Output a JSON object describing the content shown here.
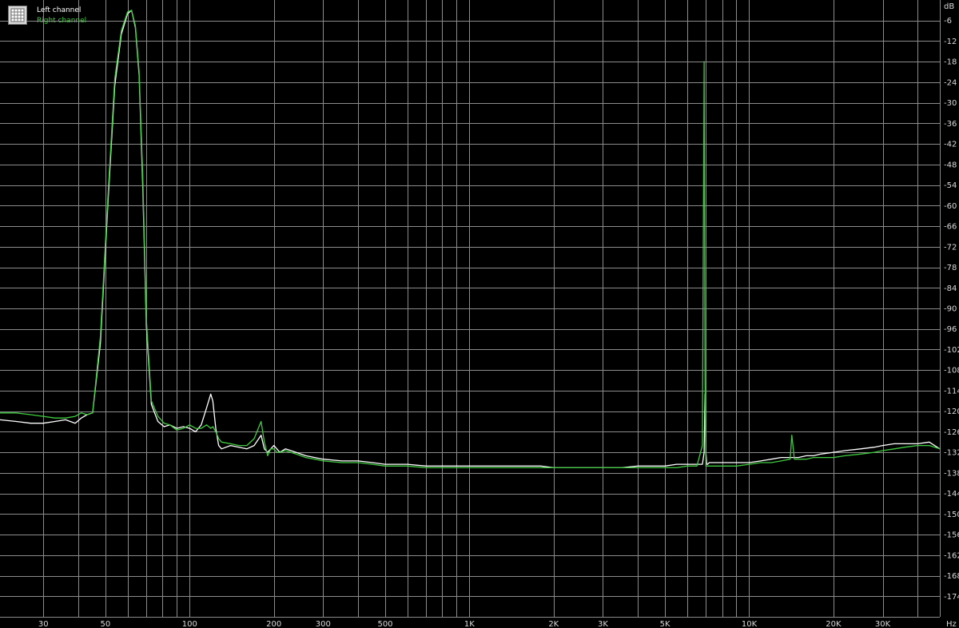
{
  "chart_data": {
    "type": "line",
    "x_scale": "log",
    "xlim": [
      21,
      48000
    ],
    "ylim": [
      -180,
      0
    ],
    "x_unit": "Hz",
    "y_unit": "dB",
    "x_tick_labels": [
      {
        "x": 30,
        "label": "30"
      },
      {
        "x": 50,
        "label": "50"
      },
      {
        "x": 100,
        "label": "100"
      },
      {
        "x": 200,
        "label": "200"
      },
      {
        "x": 300,
        "label": "300"
      },
      {
        "x": 500,
        "label": "500"
      },
      {
        "x": 1000,
        "label": "1K"
      },
      {
        "x": 2000,
        "label": "2K"
      },
      {
        "x": 3000,
        "label": "3K"
      },
      {
        "x": 5000,
        "label": "5K"
      },
      {
        "x": 10000,
        "label": "10K"
      },
      {
        "x": 20000,
        "label": "20K"
      },
      {
        "x": 30000,
        "label": "30K"
      }
    ],
    "y_ticks": [
      -6,
      -12,
      -18,
      -24,
      -30,
      -36,
      -42,
      -48,
      -54,
      -60,
      -66,
      -72,
      -78,
      -84,
      -90,
      -96,
      -102,
      -108,
      -114,
      -120,
      -126,
      -132,
      -138,
      -144,
      -150,
      -156,
      -162,
      -168,
      -174
    ],
    "grid": true,
    "legend": "top-left",
    "colors": {
      "background": "#000000",
      "grid": "#8c8c8c",
      "text": "#d8d8d8"
    },
    "series": [
      {
        "name": "Left channel",
        "color": "#ffffff",
        "x": [
          21,
          24,
          27,
          30,
          33,
          36,
          39,
          41,
          43,
          45,
          48,
          51,
          54,
          57,
          60,
          62,
          64,
          66,
          68,
          70,
          73,
          77,
          81,
          85,
          90,
          95,
          100,
          105,
          110,
          115,
          119,
          121,
          124,
          127,
          130,
          140,
          150,
          160,
          170,
          180,
          185,
          190,
          195,
          200,
          205,
          210,
          220,
          240,
          260,
          280,
          300,
          350,
          400,
          450,
          500,
          600,
          700,
          800,
          1000,
          1200,
          1500,
          1800,
          2000,
          2500,
          3000,
          3500,
          4000,
          4500,
          5000,
          5500,
          6000,
          6500,
          6800,
          6900,
          6950,
          7000,
          7050,
          7100,
          7200,
          7500,
          8000,
          9000,
          10000,
          11000,
          12000,
          13000,
          14000,
          15000,
          16000,
          17000,
          18000,
          20000,
          22000,
          25000,
          28000,
          30000,
          33000,
          36000,
          40000,
          44000,
          48000
        ],
        "y": [
          -122.5,
          -123,
          -123.5,
          -123.5,
          -123,
          -122.5,
          -123.5,
          -122,
          -121,
          -120.5,
          -100,
          -60,
          -25,
          -10,
          -4,
          -3,
          -8,
          -22,
          -55,
          -95,
          -118,
          -123,
          -124.5,
          -124,
          -125,
          -124.5,
          -125,
          -126,
          -124,
          -119,
          -115,
          -117,
          -125,
          -130,
          -131,
          -130,
          -130.5,
          -131,
          -130,
          -127,
          -131,
          -132,
          -131,
          -130,
          -131,
          -132,
          -131,
          -132,
          -133,
          -133.5,
          -134,
          -134.5,
          -134.5,
          -135,
          -135.5,
          -135.5,
          -136,
          -136,
          -136,
          -136,
          -136,
          -136,
          -136.5,
          -136.5,
          -136.5,
          -136.5,
          -136,
          -136,
          -136,
          -135.5,
          -135.5,
          -135.5,
          -135.5,
          -132,
          -115,
          -132,
          -135.5,
          -135.5,
          -135,
          -135,
          -135,
          -135,
          -135,
          -134.5,
          -134,
          -133.5,
          -133.5,
          -133.5,
          -133,
          -133,
          -132.5,
          -132,
          -131.5,
          -131,
          -130.5,
          -130,
          -129.5,
          -129.5,
          -129.5,
          -129,
          -131
        ]
      },
      {
        "name": "Right channel",
        "color": "#3fcb3f",
        "x": [
          21,
          24,
          27,
          30,
          33,
          36,
          39,
          41,
          43,
          45,
          48,
          51,
          54,
          57,
          60,
          62,
          64,
          66,
          68,
          70,
          73,
          77,
          81,
          85,
          90,
          95,
          100,
          105,
          110,
          115,
          119,
          121,
          124,
          127,
          130,
          140,
          150,
          160,
          170,
          180,
          185,
          190,
          195,
          200,
          205,
          210,
          220,
          240,
          260,
          280,
          300,
          350,
          400,
          450,
          500,
          600,
          700,
          800,
          1000,
          1200,
          1500,
          1800,
          2000,
          2500,
          3000,
          3500,
          4000,
          4500,
          5000,
          5500,
          6000,
          6500,
          6800,
          6900,
          6950,
          7000,
          7050,
          7100,
          7200,
          7500,
          8000,
          9000,
          10000,
          11000,
          12000,
          13000,
          14000,
          14200,
          14500,
          15000,
          16000,
          17000,
          18000,
          20000,
          22000,
          25000,
          28000,
          30000,
          33000,
          36000,
          40000,
          44000,
          48000
        ],
        "y": [
          -120.5,
          -120.5,
          -121,
          -121.5,
          -122,
          -122,
          -121.5,
          -120.5,
          -121,
          -120.5,
          -98,
          -58,
          -23,
          -9,
          -3.5,
          -3,
          -7.5,
          -21,
          -52,
          -93,
          -117,
          -121.5,
          -123.5,
          -124,
          -125.5,
          -125,
          -124,
          -125,
          -125,
          -124,
          -125,
          -124.5,
          -126,
          -128,
          -129,
          -129.5,
          -130,
          -130,
          -128,
          -123,
          -129,
          -133,
          -131,
          -131,
          -132,
          -132,
          -131.5,
          -132.5,
          -133.5,
          -134,
          -134.5,
          -135,
          -135,
          -135.5,
          -136,
          -136,
          -136.5,
          -136.5,
          -136.5,
          -136.5,
          -136.5,
          -136.5,
          -136.5,
          -136.5,
          -136.5,
          -136.5,
          -136.5,
          -136.5,
          -136.5,
          -136.5,
          -136,
          -136,
          -130,
          -18,
          -110,
          -136,
          -136,
          -136,
          -136,
          -136,
          -136,
          -136,
          -135.5,
          -135,
          -135,
          -134.5,
          -134,
          -127,
          -134,
          -134,
          -134,
          -133.5,
          -133.5,
          -133.5,
          -133,
          -132.5,
          -132,
          -131.5,
          -131,
          -130.5,
          -130,
          -130,
          -131
        ]
      }
    ]
  }
}
